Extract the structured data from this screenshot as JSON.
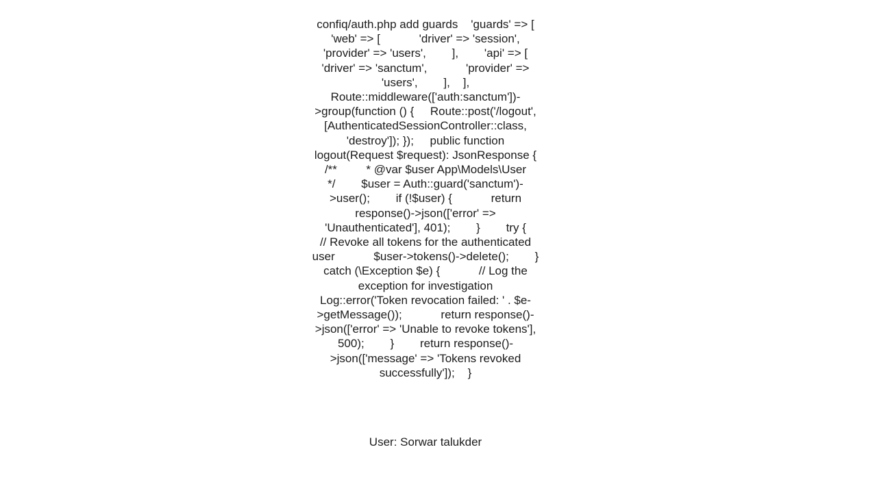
{
  "page": {
    "background_color": "#ffffff",
    "text_color": "#1b1b1b"
  },
  "content": {
    "code_text": "confiq/auth.php add guards    'guards' => [        'web' => [            'driver' => 'session',            'provider' => 'users',        ],        'api' => [            'driver' => 'sanctum',            'provider' => 'users',        ],    ],  Route::middleware(['auth:sanctum'])->group(function () {     Route::post('/logout', [AuthenticatedSessionController::class, 'destroy']); });     public function logout(Request $request): JsonResponse {        /**         * @var $user App\\Models\\User         */        $user = Auth::guard('sanctum')->user();        if (!$user) {            return response()->json(['error' => 'Unauthenticated'], 401);        }        try {            // Revoke all tokens for the authenticated user            $user->tokens()->delete();        } catch (\\Exception $e) {            // Log the exception for investigation            Log::error('Token revocation failed: ' . $e->getMessage());            return response()->json(['error' => 'Unable to revoke tokens'], 500);        }        return response()->json(['message' => 'Tokens revoked successfully']);    }",
    "footer": "User: Sorwar talukder"
  }
}
